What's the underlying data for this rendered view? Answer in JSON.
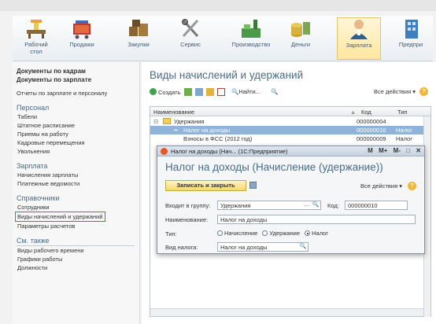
{
  "ribbon": {
    "items": [
      {
        "label": "Рабочий\nстол",
        "icon": "desk-icon"
      },
      {
        "label": "Продажи",
        "icon": "cart-icon"
      },
      {
        "label": "Закупки",
        "icon": "boxes-icon"
      },
      {
        "label": "Сервис",
        "icon": "tools-icon"
      },
      {
        "label": "Производство",
        "icon": "factory-icon"
      },
      {
        "label": "Деньги",
        "icon": "coins-icon"
      },
      {
        "label": "Зарплата",
        "icon": "person-icon"
      },
      {
        "label": "Предпри",
        "icon": "building-icon"
      }
    ]
  },
  "left_panel": {
    "top_links": [
      "Документы по кадрам",
      "Документы по зарплате"
    ],
    "report_link": "Отчеты по зарплате и персоналу",
    "groups": [
      {
        "title": "Персонал",
        "items": [
          "Табели",
          "Штатное расписание",
          "Приемы на работу",
          "Кадровые перемещения",
          "Увольнения"
        ]
      },
      {
        "title": "Зарплата",
        "items": [
          "Начисления зарплаты",
          "Платежные ведомости"
        ]
      },
      {
        "title": "Справочники",
        "items": [
          "Сотрудники",
          "Виды начислений и удержаний",
          "Параметры расчетов"
        ]
      },
      {
        "title": "См. также",
        "items": [
          "Виды рабочего времени",
          "Графики работы",
          "Должности"
        ]
      }
    ]
  },
  "main": {
    "title": "Виды начислений и удержаний",
    "toolbar": {
      "create": "Создать",
      "find": "Найти...",
      "all_actions": "Все действия ▾",
      "help": "?"
    },
    "columns": [
      "Наименование",
      "Код",
      "Тип"
    ],
    "rows": [
      {
        "name": "Удержания",
        "code": "000000004",
        "type": ""
      },
      {
        "name": "Налог на доходы",
        "code": "000000010",
        "type": "Налог"
      },
      {
        "name": "Взносы в ФСС (2012 год)",
        "code": "000000009",
        "type": "Налог"
      }
    ]
  },
  "dialog": {
    "window_title": "Налог на доходы (Нач... (1С:Предприятие)",
    "title_buttons": [
      "M",
      "M+",
      "M-",
      "□",
      "✕"
    ],
    "heading": "Налог на доходы (Начисление (удержание))",
    "save_close": "Записать и закрыть",
    "all_actions": "Все действия ▾",
    "help": "?",
    "fields": {
      "group_label": "Входит в группу:",
      "group_value": "Удержания",
      "code_label": "Код:",
      "code_value": "000000010",
      "name_label": "Наименование:",
      "name_value": "Налог на доходы",
      "type_label": "Тип:",
      "type_options": [
        "Начисление",
        "Удержание",
        "Налог"
      ],
      "type_selected": "Налог",
      "tax_label": "Вид налога:",
      "tax_value": "Налог на доходы"
    }
  },
  "colors": {
    "accent": "#4a6b8a",
    "selection": "#8fb3d9",
    "highlight_frame": "#d9463e",
    "save_button": "#f6d86e"
  }
}
